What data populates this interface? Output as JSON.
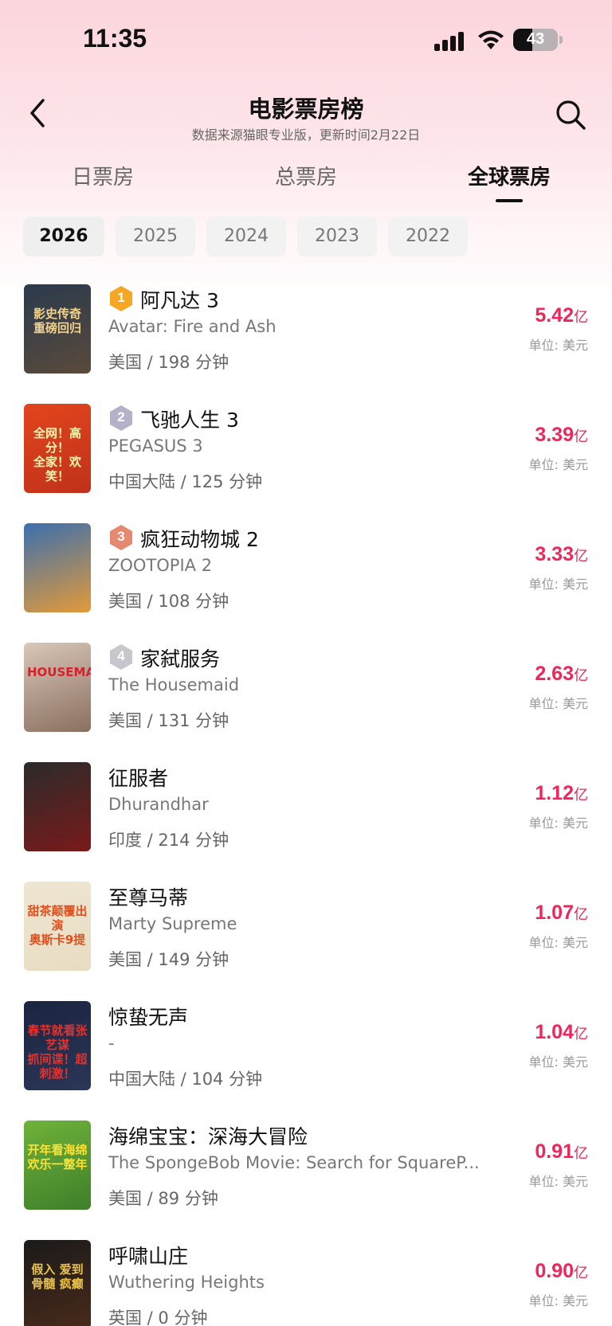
{
  "status_bar": {
    "time": "11:35",
    "battery": "43"
  },
  "header": {
    "title": "电影票房榜",
    "subtitle": "数据来源猫眼专业版，更新时间2月22日"
  },
  "tabs": [
    {
      "label": "日票房",
      "active": false
    },
    {
      "label": "总票房",
      "active": false
    },
    {
      "label": "全球票房",
      "active": true
    }
  ],
  "years": [
    {
      "label": "2026",
      "active": true
    },
    {
      "label": "2025",
      "active": false
    },
    {
      "label": "2024",
      "active": false
    },
    {
      "label": "2023",
      "active": false
    },
    {
      "label": "2022",
      "active": false
    }
  ],
  "unit_suffix": "亿",
  "unit_label": "单位: 美元",
  "movies": [
    {
      "rank": "1",
      "title": "阿凡达 3",
      "en": "Avatar: Fire and Ash",
      "meta": "美国 / 198 分钟",
      "amount": "5.42",
      "badge_color": "#f5a623",
      "poster_colors": [
        "#2a3a4e",
        "#5a4a3a"
      ],
      "poster_text": "影史传奇\n重磅回归",
      "poster_text_color": "#f4d38a"
    },
    {
      "rank": "2",
      "title": "飞驰人生 3",
      "en": "PEGASUS 3",
      "meta": "中国大陆 / 125 分钟",
      "amount": "3.39",
      "badge_color": "#b4b2c8",
      "poster_colors": [
        "#e2451d",
        "#c0311a"
      ],
      "poster_text": "全网！高分！\n全家！欢笑！",
      "poster_text_color": "#fff6b0"
    },
    {
      "rank": "3",
      "title": "疯狂动物城 2",
      "en": "ZOOTOPIA 2",
      "meta": "美国 / 108 分钟",
      "amount": "3.33",
      "badge_color": "#e58a70",
      "poster_colors": [
        "#3b6fae",
        "#e39a3a"
      ],
      "poster_text": "",
      "poster_text_color": "#ffffff"
    },
    {
      "rank": "4",
      "title": "家弑服务",
      "en": "The Housemaid",
      "meta": "美国 / 131 分钟",
      "amount": "2.63",
      "badge_color": "#c6c6cc",
      "poster_colors": [
        "#d9c7b8",
        "#8a6f60"
      ],
      "poster_text": "HOUSEMAID",
      "poster_text_color": "#d8202a"
    },
    {
      "rank": "",
      "title": "征服者",
      "en": "Dhurandhar",
      "meta": "印度 / 214 分钟",
      "amount": "1.12",
      "badge_color": "",
      "poster_colors": [
        "#2b2b2b",
        "#7a1a1a"
      ],
      "poster_text": "",
      "poster_text_color": "#ffffff"
    },
    {
      "rank": "",
      "title": "至尊马蒂",
      "en": "Marty Supreme",
      "meta": "美国 / 149 分钟",
      "amount": "1.07",
      "badge_color": "",
      "poster_colors": [
        "#efe6d2",
        "#e8dcc2"
      ],
      "poster_text": "甜茶颠覆出演\n奥斯卡9提",
      "poster_text_color": "#e0501e"
    },
    {
      "rank": "",
      "title": "惊蛰无声",
      "en": "-",
      "meta": "中国大陆 / 104 分钟",
      "amount": "1.04",
      "badge_color": "",
      "poster_colors": [
        "#1b2540",
        "#2b3658"
      ],
      "poster_text": "春节就看张艺谋\n抓间谍！超刺激！",
      "poster_text_color": "#e8302a"
    },
    {
      "rank": "",
      "title": "海绵宝宝：深海大冒险",
      "en": "The SpongeBob Movie: Search for SquareP...",
      "meta": "美国 / 89 分钟",
      "amount": "0.91",
      "badge_color": "",
      "poster_colors": [
        "#6fb23a",
        "#3e7f2a"
      ],
      "poster_text": "开年看海绵\n欢乐一整年",
      "poster_text_color": "#ffe033"
    },
    {
      "rank": "",
      "title": "呼啸山庄",
      "en": "Wuthering Heights",
      "meta": "英国 / 0 分钟",
      "amount": "0.90",
      "badge_color": "",
      "poster_colors": [
        "#1a1a1a",
        "#4a2a1a"
      ],
      "poster_text": "假入 爱到\n骨髓 疯癫",
      "poster_text_color": "#e8c24a"
    }
  ]
}
